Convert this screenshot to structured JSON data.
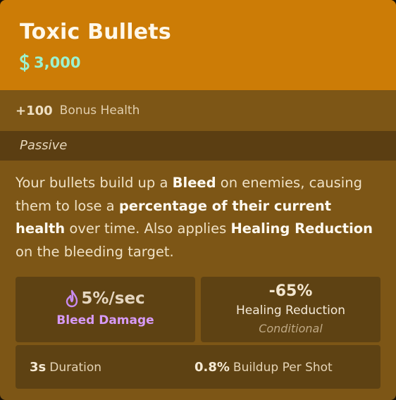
{
  "item": {
    "name": "Toxic Bullets",
    "price": "3,000",
    "colors": {
      "header": "#cc7c06",
      "body": "#7d5616",
      "price": "#9cf2ce",
      "bleed": "#d79af7"
    }
  },
  "bonus": {
    "value": "+100",
    "label": "Bonus Health"
  },
  "passive": {
    "label": "Passive",
    "description": {
      "p1": "Your bullets build up a ",
      "b1": "Bleed",
      "p2": " on enemies, causing them to lose a ",
      "b2": "percentage of their current health",
      "p3": " over time. Also applies ",
      "b3": "Healing Reduction",
      "p4": " on the bleeding target."
    }
  },
  "stats": {
    "bleed": {
      "value": "5%/sec",
      "label": "Bleed Damage",
      "icon": "bleed-drop-icon"
    },
    "healing": {
      "value": "-65%",
      "label": "Healing Reduction",
      "condition": "Conditional"
    },
    "duration": {
      "value": "3s",
      "label": "Duration"
    },
    "buildup": {
      "value": "0.8%",
      "label": "Buildup Per Shot"
    }
  }
}
